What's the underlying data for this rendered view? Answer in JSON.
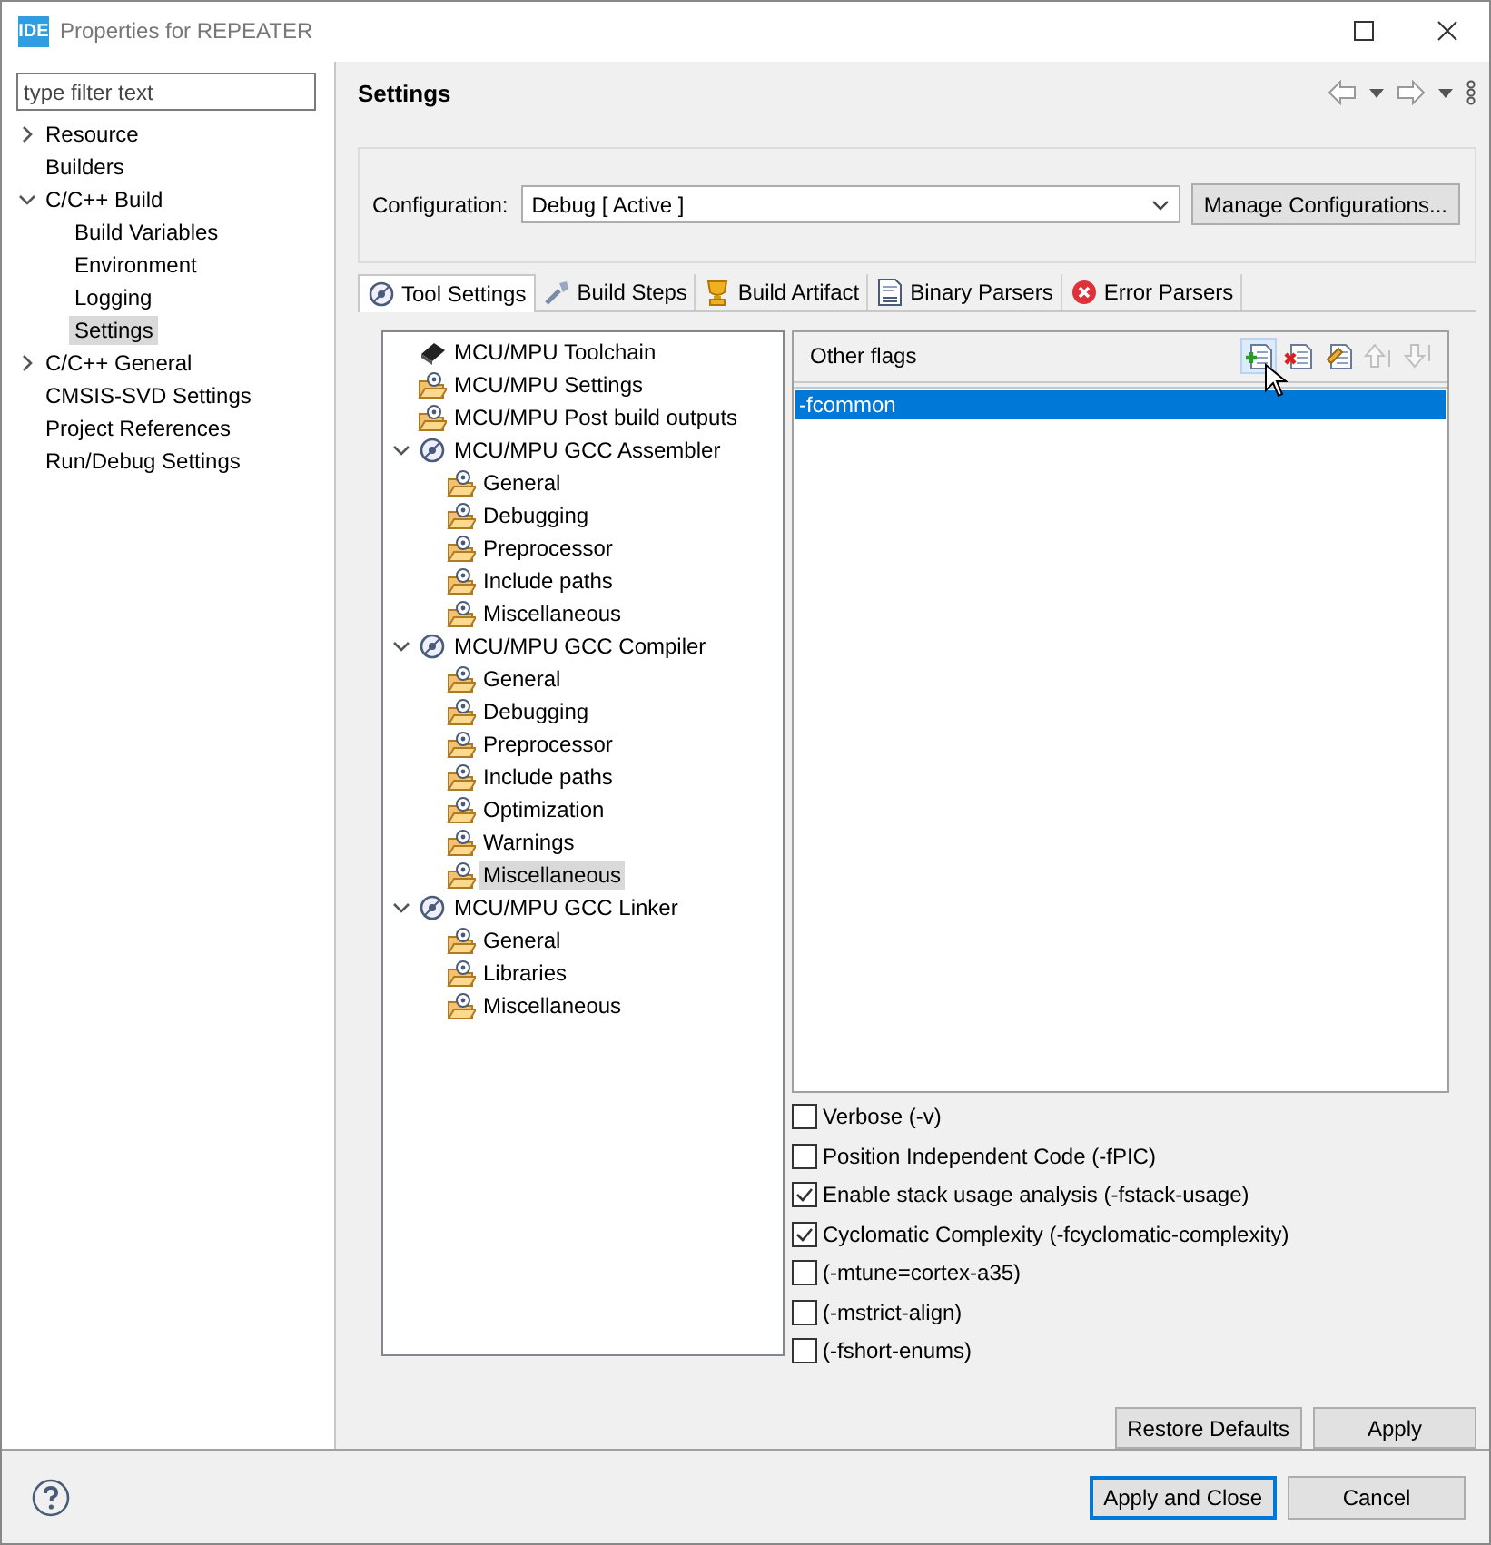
{
  "window": {
    "badge": "IDE",
    "title": "Properties for REPEATER"
  },
  "filter": {
    "placeholder": "type filter text"
  },
  "sidebar": {
    "items": [
      {
        "label": "Resource",
        "expanded": false,
        "selected": false
      },
      {
        "label": "Builders",
        "selected": false
      },
      {
        "label": "C/C++ Build",
        "expanded": true,
        "selected": false,
        "children": [
          {
            "label": "Build Variables",
            "selected": false
          },
          {
            "label": "Environment",
            "selected": false
          },
          {
            "label": "Logging",
            "selected": false
          },
          {
            "label": "Settings",
            "selected": true
          }
        ]
      },
      {
        "label": "C/C++ General",
        "expanded": false,
        "selected": false
      },
      {
        "label": "CMSIS-SVD Settings",
        "selected": false
      },
      {
        "label": "Project References",
        "selected": false
      },
      {
        "label": "Run/Debug Settings",
        "selected": false
      }
    ]
  },
  "page": {
    "title": "Settings"
  },
  "configuration": {
    "label": "Configuration:",
    "value": "Debug  [ Active ]",
    "button": "Manage Configurations..."
  },
  "tabs": [
    {
      "label": "Tool Settings",
      "kind": "tool",
      "selected": true
    },
    {
      "label": "Build Steps",
      "kind": "steps",
      "selected": false
    },
    {
      "label": "Build Artifact",
      "kind": "artifact",
      "selected": false
    },
    {
      "label": "Binary Parsers",
      "kind": "binary",
      "selected": false
    },
    {
      "label": "Error Parsers",
      "kind": "error",
      "selected": false
    }
  ],
  "tool_tree": [
    {
      "label": "MCU/MPU Toolchain",
      "kind": "chip",
      "selected": false
    },
    {
      "label": "MCU/MPU Settings",
      "kind": "options",
      "selected": false
    },
    {
      "label": "MCU/MPU Post build outputs",
      "kind": "options",
      "selected": false
    },
    {
      "label": "MCU/MPU GCC Assembler",
      "kind": "tool",
      "expanded": true,
      "selected": false,
      "children": [
        {
          "label": "General",
          "kind": "options",
          "selected": false
        },
        {
          "label": "Debugging",
          "kind": "options",
          "selected": false
        },
        {
          "label": "Preprocessor",
          "kind": "options",
          "selected": false
        },
        {
          "label": "Include paths",
          "kind": "options",
          "selected": false
        },
        {
          "label": "Miscellaneous",
          "kind": "options",
          "selected": false
        }
      ]
    },
    {
      "label": "MCU/MPU GCC Compiler",
      "kind": "tool",
      "expanded": true,
      "selected": false,
      "children": [
        {
          "label": "General",
          "kind": "options",
          "selected": false
        },
        {
          "label": "Debugging",
          "kind": "options",
          "selected": false
        },
        {
          "label": "Preprocessor",
          "kind": "options",
          "selected": false
        },
        {
          "label": "Include paths",
          "kind": "options",
          "selected": false
        },
        {
          "label": "Optimization",
          "kind": "options",
          "selected": false
        },
        {
          "label": "Warnings",
          "kind": "options",
          "selected": false
        },
        {
          "label": "Miscellaneous",
          "kind": "options",
          "selected": true
        }
      ]
    },
    {
      "label": "MCU/MPU GCC Linker",
      "kind": "tool",
      "expanded": true,
      "selected": false,
      "children": [
        {
          "label": "General",
          "kind": "options",
          "selected": false
        },
        {
          "label": "Libraries",
          "kind": "options",
          "selected": false
        },
        {
          "label": "Miscellaneous",
          "kind": "options",
          "selected": false
        }
      ]
    }
  ],
  "other_flags": {
    "title": "Other flags",
    "tools": [
      {
        "kind": "add",
        "disabled": false
      },
      {
        "kind": "delete",
        "disabled": false
      },
      {
        "kind": "edit",
        "disabled": false
      },
      {
        "kind": "up",
        "disabled": true
      },
      {
        "kind": "down",
        "disabled": true
      }
    ],
    "values": [
      {
        "text": "-fcommon",
        "selected": true
      }
    ]
  },
  "options": [
    {
      "label": "Verbose (-v)",
      "checked": false
    },
    {
      "label": "Position Independent Code (-fPIC)",
      "checked": false
    },
    {
      "label": "Enable stack usage analysis (-fstack-usage)",
      "checked": true
    },
    {
      "label": "Cyclomatic Complexity (-fcyclomatic-complexity)",
      "checked": true
    },
    {
      "label": "(-mtune=cortex-a35)",
      "checked": false
    },
    {
      "label": "(-mstrict-align)",
      "checked": false
    },
    {
      "label": "(-fshort-enums)",
      "checked": false
    }
  ],
  "page_buttons": [
    "Restore Defaults",
    "Apply"
  ],
  "dialog_buttons": [
    {
      "label": "Apply and Close",
      "default": true
    },
    {
      "label": "Cancel",
      "default": false
    }
  ]
}
